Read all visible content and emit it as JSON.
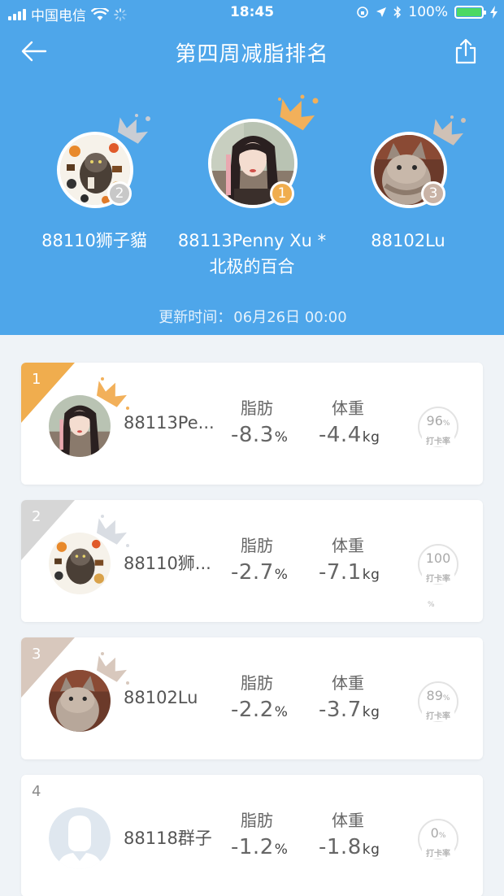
{
  "status_bar": {
    "carrier": "中国电信",
    "time": "18:45",
    "battery": "100%"
  },
  "nav": {
    "title": "第四周减脂排名",
    "back_icon": "arrow-left-icon",
    "share_icon": "share-icon"
  },
  "podium": [
    {
      "rank": "2",
      "name": "88110狮子貓",
      "badge_color": "#c8c8c8",
      "crown_color": "#c9cdd4"
    },
    {
      "rank": "1",
      "name": "88113Penny Xu *\n北极的百合",
      "badge_color": "#f0ad4e",
      "crown_color": "#f2b05a"
    },
    {
      "rank": "3",
      "name": "88102Lu",
      "badge_color": "#c9b3a6",
      "crown_color": "#cfc1b6"
    }
  ],
  "updated": {
    "label": "更新时间：",
    "value": "06月26日 00:00"
  },
  "metric_labels": {
    "fat": "脂肪",
    "weight": "体重",
    "checkin": "打卡率"
  },
  "ranking": [
    {
      "rank": "1",
      "name": "88113Pe...",
      "fat": "-8.3",
      "fat_unit": "%",
      "weight": "-4.4",
      "weight_unit": "kg",
      "checkin": "96",
      "checkin_unit": "%",
      "corner_color": "#f0ad4e",
      "crown_color": "#f2b05a"
    },
    {
      "rank": "2",
      "name": "88110狮...",
      "fat": "-2.7",
      "fat_unit": "%",
      "weight": "-7.1",
      "weight_unit": "kg",
      "checkin": "100",
      "checkin_unit": "%",
      "corner_color": "#d6d6d6",
      "crown_color": "#d9dde3"
    },
    {
      "rank": "3",
      "name": "88102Lu",
      "fat": "-2.2",
      "fat_unit": "%",
      "weight": "-3.7",
      "weight_unit": "kg",
      "checkin": "89",
      "checkin_unit": "%",
      "corner_color": "#d8c8bd",
      "crown_color": "#d8c8bd"
    },
    {
      "rank": "4",
      "name": "88118群子",
      "fat": "-1.2",
      "fat_unit": "%",
      "weight": "-1.8",
      "weight_unit": "kg",
      "checkin": "0",
      "checkin_unit": "%",
      "corner_color": "",
      "crown_color": ""
    }
  ]
}
